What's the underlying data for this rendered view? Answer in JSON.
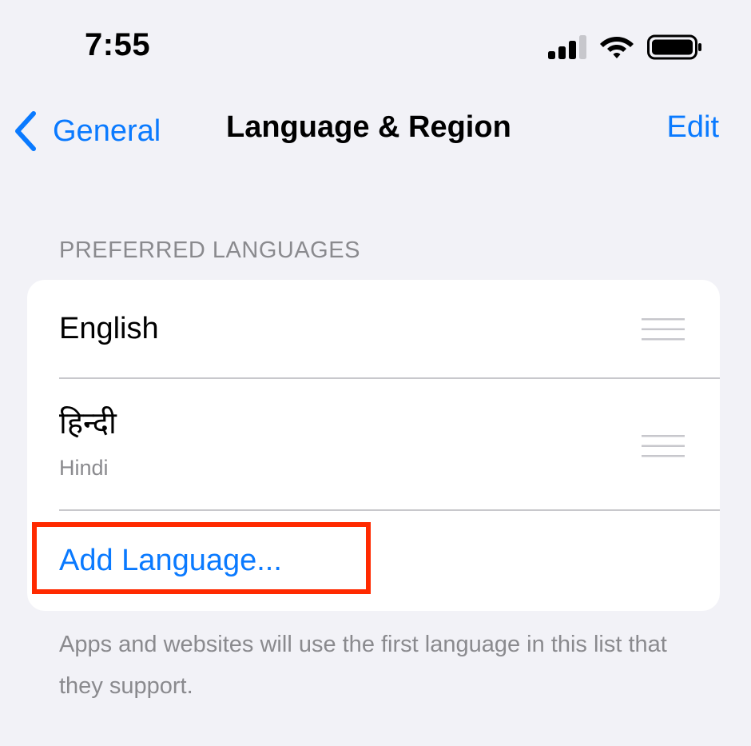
{
  "status_bar": {
    "time": "7:55",
    "signal_icon": "cellular-signal-icon",
    "wifi_icon": "wifi-icon",
    "battery_icon": "battery-icon"
  },
  "nav": {
    "back_label": "General",
    "title": "Language & Region",
    "edit_label": "Edit",
    "accent_color": "#0a7aff"
  },
  "preferred_languages": {
    "header": "PREFERRED LANGUAGES",
    "items": [
      {
        "name": "English",
        "subtitle": ""
      },
      {
        "name": "हिन्दी",
        "subtitle": "Hindi"
      }
    ],
    "add_label": "Add Language...",
    "footer": "Apps and websites will use the first language in this list that they support."
  },
  "highlight_color": "#ff2a00"
}
